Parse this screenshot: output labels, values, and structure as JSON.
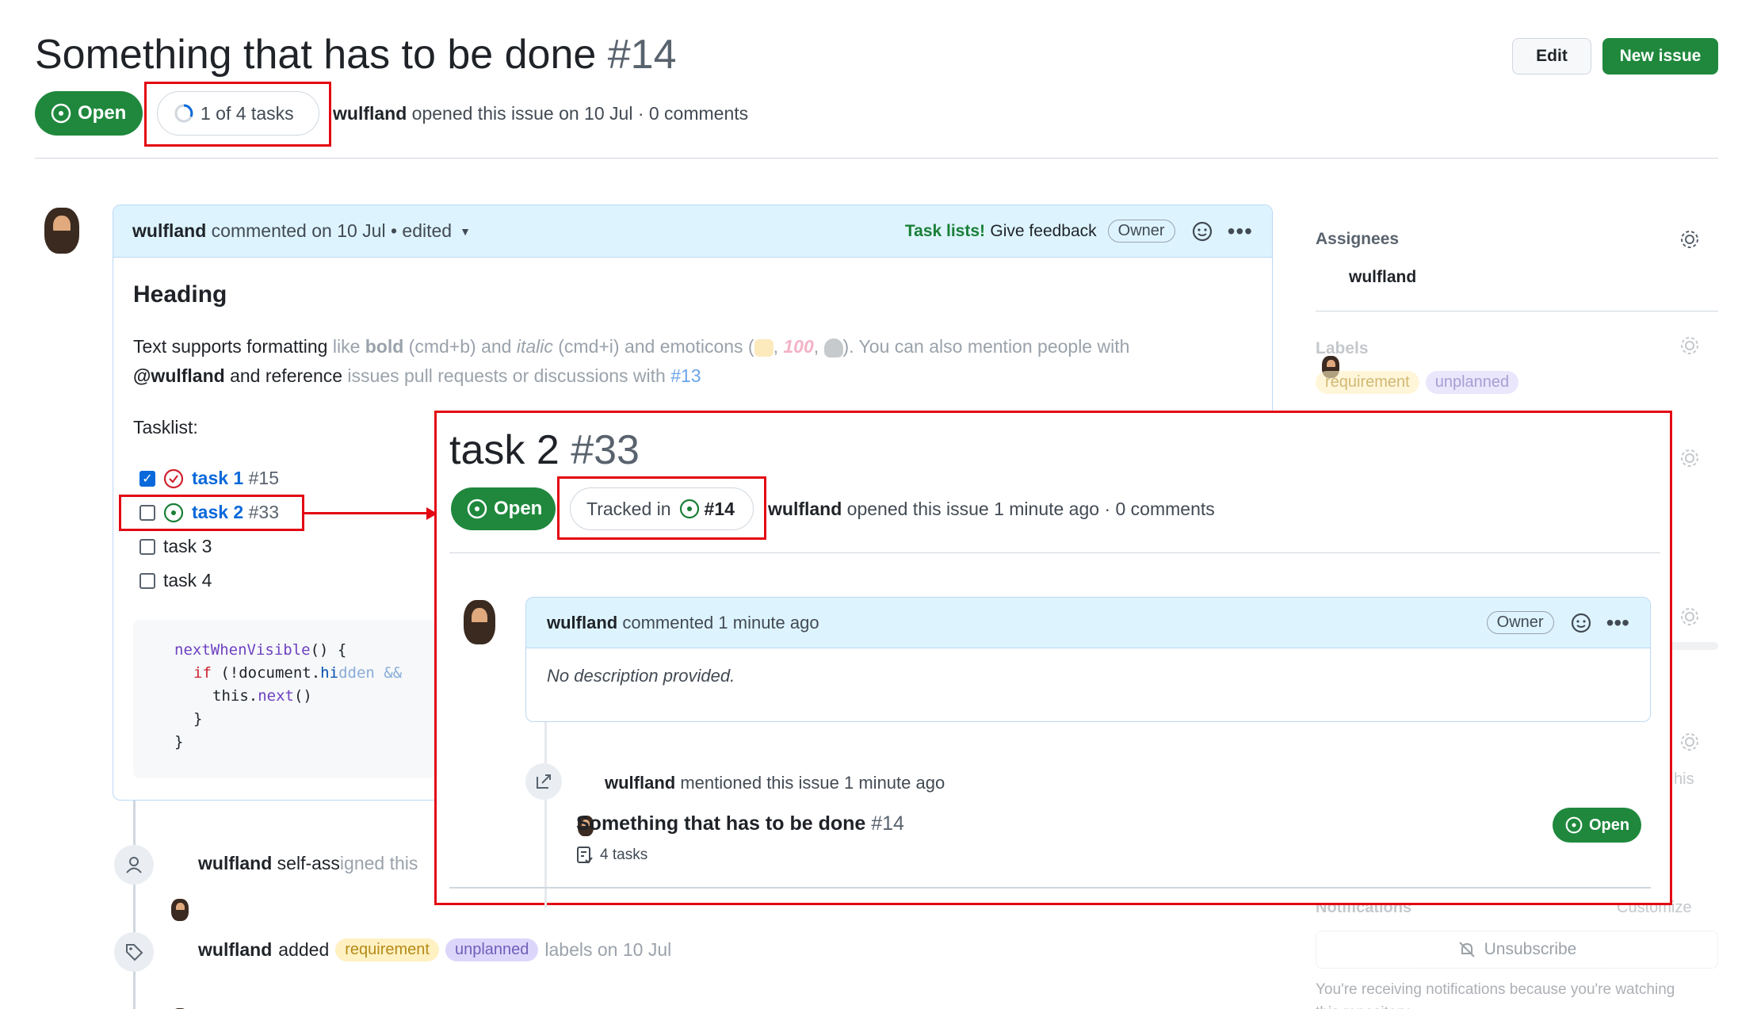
{
  "header": {
    "title": "Something that has to be done",
    "number": "#14",
    "status": "Open",
    "tasks_badge": "1 of 4 tasks",
    "author": "wulfland",
    "meta": "opened this issue on 10 Jul · 0 comments",
    "edit_label": "Edit",
    "new_issue_label": "New issue"
  },
  "comment": {
    "author": "wulfland",
    "meta": "commented on 10 Jul",
    "edited": "• edited",
    "task_lists": "Task lists!",
    "give_feedback": "Give feedback",
    "owner": "Owner",
    "heading": "Heading",
    "text1_a": "Text supports formatting ",
    "text1_b": "like ",
    "text1_bold": "bold",
    "text1_c": " (cmd+b) and ",
    "text1_italic": "italic",
    "text1_d": " (cmd+i) and emoticons (",
    "text1_e": "). You can also mention people with",
    "text2_mention": "@wulfland",
    "text2_a": " and reference ",
    "text2_b": "issues pull requests or discussions with ",
    "text2_ref": "#13",
    "tasklist_label": "Tasklist:",
    "tasks": [
      {
        "title": "task 1",
        "number": "#15",
        "checked": true
      },
      {
        "title": "task 2",
        "number": "#33",
        "checked": false
      },
      {
        "title": "task 3",
        "number": "",
        "checked": false
      },
      {
        "title": "task 4",
        "number": "",
        "checked": false
      }
    ],
    "code": {
      "line1_fn": "nextWhenVisible",
      "line1_rest": "() {",
      "line2_kw": "if",
      "line2_a": " (!document.",
      "line2_b": "hi",
      "line2_c": "dden &&",
      "line3_a": "this.",
      "line3_b": "next",
      "line3_c": "()",
      "line4": "}",
      "line5": "}"
    }
  },
  "timeline": {
    "self_assigned_author": "wulfland",
    "self_assigned_a": "self-ass",
    "self_assigned_b": "igned this",
    "labels_author": "wulfland",
    "labels_added": "added",
    "labels_suffix": "labels on 10 Jul"
  },
  "sidebar": {
    "assignees_label": "Assignees",
    "assignee": "wulfland",
    "labels_label": "Labels",
    "labels": [
      "requirement",
      "unplanned"
    ],
    "notifications_label": "Notifications",
    "customize": "Customize",
    "unsubscribe": "Unsubscribe",
    "notice": "You're receiving notifications because you're watching this repository.",
    "partial_text": "his"
  },
  "popup": {
    "title": "task 2",
    "number": "#33",
    "status": "Open",
    "tracked_in": "Tracked in",
    "tracked_ref": "#14",
    "author": "wulfland",
    "meta": "opened this issue 1 minute ago · 0 comments",
    "comment_author": "wulfland",
    "comment_meta": "commented 1 minute ago",
    "owner": "Owner",
    "no_description": "No description provided.",
    "mention_author": "wulfland",
    "mention_meta": "mentioned this issue 1 minute ago",
    "ref_title": "Something that has to be done",
    "ref_number": "#14",
    "ref_status": "Open",
    "ref_tasks": "4 tasks"
  },
  "colors": {
    "green": "#1f883d",
    "blue": "#0969da",
    "red_annotation": "#e30613"
  },
  "icons": [
    "issue-open-icon",
    "progress-icon",
    "check-circle-icon",
    "smiley-icon",
    "kebab-icon",
    "gear-icon",
    "person-icon",
    "tag-icon",
    "cross-reference-icon",
    "tasklist-icon",
    "bell-slash-icon",
    "caret-down-icon"
  ]
}
